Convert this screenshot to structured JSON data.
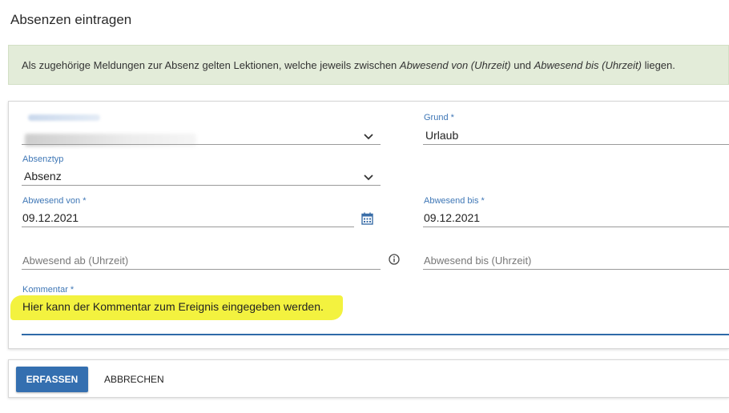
{
  "page": {
    "title": "Absenzen eintragen"
  },
  "banner": {
    "text_1": "Als zugehörige Meldungen zur Absenz gelten Lektionen, welche jeweils zwischen ",
    "em_1": "Abwesend von (Uhrzeit)",
    "text_2": " und ",
    "em_2": "Abwesend bis (Uhrzeit)",
    "text_3": " liegen."
  },
  "form": {
    "schueler": {
      "icon": "chevron-down-icon"
    },
    "grund": {
      "label": "Grund *",
      "value": "Urlaub"
    },
    "absenztyp": {
      "label": "Absenztyp",
      "value": "Absenz",
      "icon": "chevron-down-icon"
    },
    "abwesend_von": {
      "label": "Abwesend von *",
      "value": "09.12.2021",
      "icon": "calendar-icon"
    },
    "abwesend_bis": {
      "label": "Abwesend bis *",
      "value": "09.12.2021"
    },
    "abwesend_ab_uhrzeit": {
      "placeholder": "Abwesend ab (Uhrzeit)",
      "icon": "info-icon"
    },
    "abwesend_bis_uhrzeit": {
      "placeholder": "Abwesend bis (Uhrzeit)"
    },
    "kommentar": {
      "label": "Kommentar *",
      "value": "Hier kann der Kommentar zum Ereignis eingegeben werden."
    }
  },
  "actions": {
    "submit_label": "ERFASSEN",
    "cancel_label": "ABBRECHEN"
  },
  "colors": {
    "accent": "#346fb0",
    "label": "#3f77b6",
    "banner_bg": "#e3ecd9",
    "highlight": "#f3f23f"
  }
}
